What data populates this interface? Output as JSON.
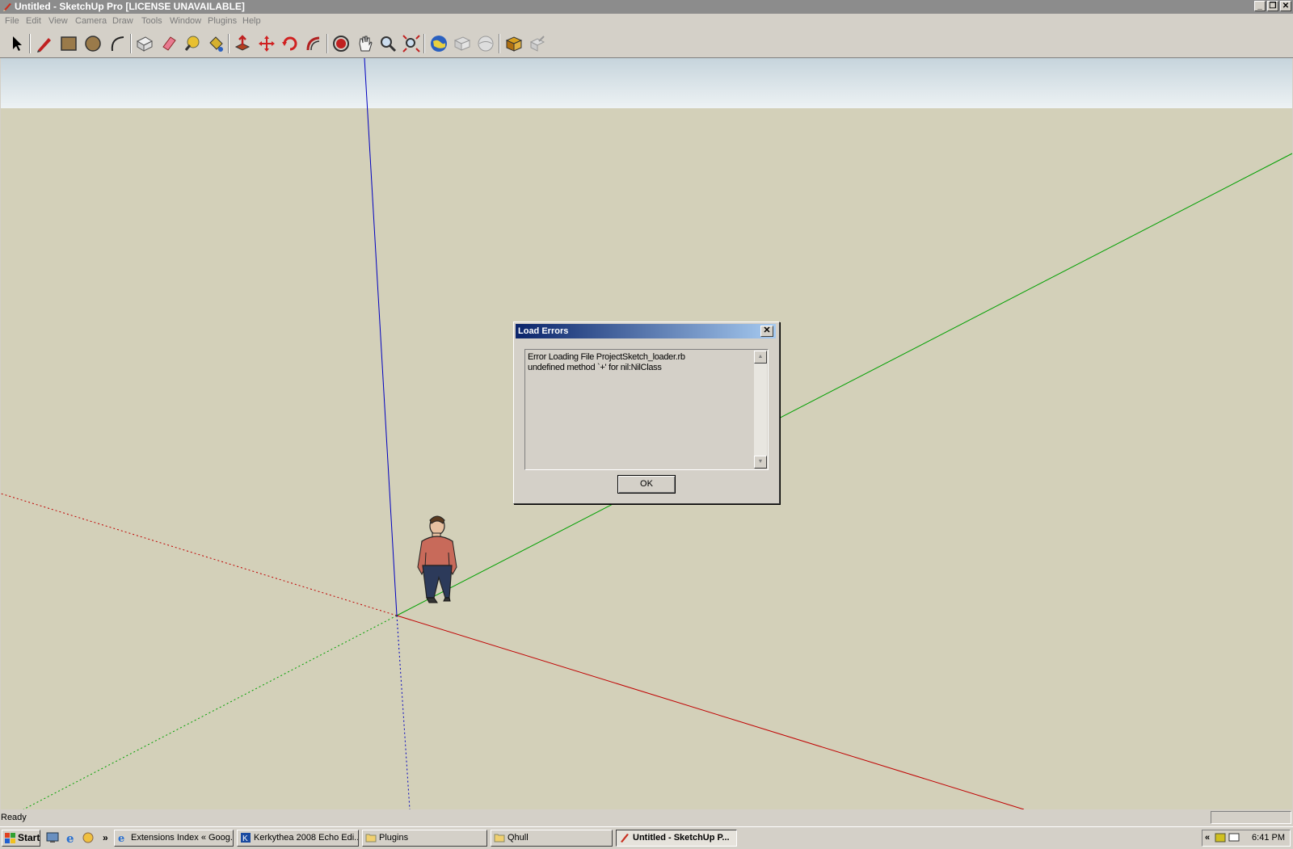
{
  "window": {
    "title": "Untitled - SketchUp Pro [LICENSE UNAVAILABLE]"
  },
  "menu": [
    "File",
    "Edit",
    "View",
    "Camera",
    "Draw",
    "Tools",
    "Window",
    "Plugins",
    "Help"
  ],
  "toolbar_icons": [
    "select-icon",
    "pencil-icon",
    "rectangle-icon",
    "circle-icon",
    "arc-icon",
    "make-component-icon",
    "eraser-icon",
    "tape-measure-icon",
    "paint-bucket-icon",
    "push-pull-icon",
    "move-icon",
    "rotate-icon",
    "follow-me-icon",
    "orbit-icon",
    "pan-icon",
    "zoom-icon",
    "zoom-extents-icon",
    "google-earth-icon",
    "import-terrain-icon",
    "toggle-terrain-icon",
    "get-models-icon",
    "share-model-icon"
  ],
  "dialog": {
    "title": "Load Errors",
    "lines": [
      "Error Loading File ProjectSketch_loader.rb",
      "undefined method `+' for nil:NilClass"
    ],
    "ok_label": "OK"
  },
  "status": {
    "text": "Ready"
  },
  "taskbar": {
    "start_label": "Start",
    "overflow_label": "»",
    "tasks": [
      {
        "label": "Extensions Index « Goog...",
        "icon": "ie-icon"
      },
      {
        "label": "Kerkythea 2008 Echo Edi...",
        "icon": "kerkythea-icon"
      },
      {
        "label": "Plugins",
        "icon": "folder-icon"
      },
      {
        "label": "Qhull",
        "icon": "folder-icon"
      },
      {
        "label": "Untitled - SketchUp P...",
        "icon": "sketchup-icon",
        "active": true
      }
    ],
    "tray_chevron": "«",
    "clock": "6:41 PM"
  },
  "colors": {
    "ground": "#d3d0b9",
    "sky_top": "#c6d4dc",
    "sky_bottom": "#edf2f4",
    "red_axis": "#c00000",
    "green_axis": "#00a000",
    "blue_axis": "#0000c0"
  }
}
